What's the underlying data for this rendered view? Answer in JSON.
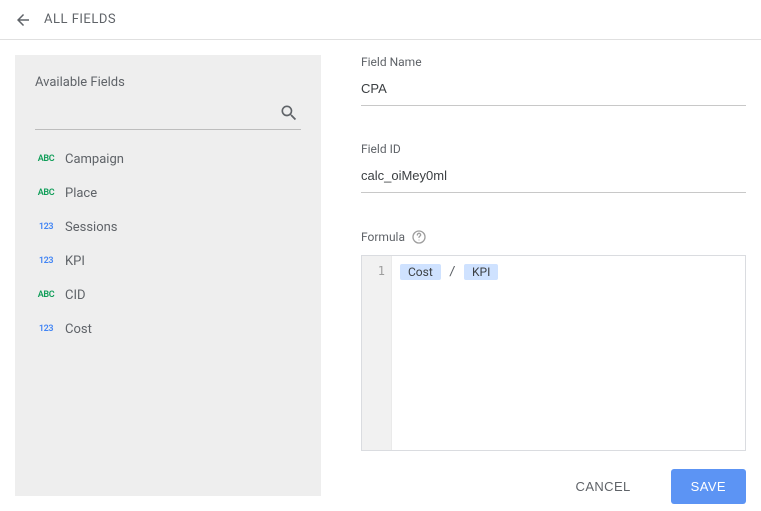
{
  "header": {
    "title": "ALL FIELDS"
  },
  "sidebar": {
    "title": "Available Fields",
    "search_placeholder": "",
    "items": [
      {
        "type": "ABC",
        "label": "Campaign"
      },
      {
        "type": "ABC",
        "label": "Place"
      },
      {
        "type": "123",
        "label": "Sessions"
      },
      {
        "type": "123",
        "label": "KPI"
      },
      {
        "type": "ABC",
        "label": "CID"
      },
      {
        "type": "123",
        "label": "Cost"
      }
    ]
  },
  "form": {
    "field_name_label": "Field Name",
    "field_name_value": "CPA",
    "field_id_label": "Field ID",
    "field_id_value": "calc_oiMey0ml",
    "formula_label": "Formula",
    "line_number": "1",
    "token_a": "Cost",
    "operator": "/",
    "token_b": "KPI"
  },
  "buttons": {
    "cancel": "CANCEL",
    "save": "SAVE"
  }
}
